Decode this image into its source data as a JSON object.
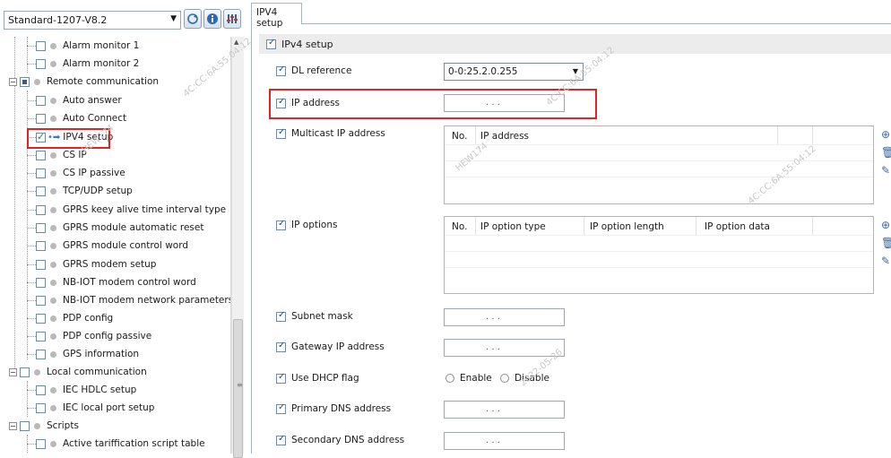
{
  "toolbar": {
    "profile_select_value": "Standard-1207-V8.2",
    "buttons": [
      "refresh-icon",
      "info-icon",
      "settings-icon"
    ]
  },
  "tree": {
    "items": [
      {
        "label": "Alarm monitor 1"
      },
      {
        "label": "Alarm monitor 2"
      },
      {
        "label": "Remote communication"
      },
      {
        "label": "Auto answer"
      },
      {
        "label": "Auto Connect"
      },
      {
        "label": "IPV4 setup"
      },
      {
        "label": "CS IP"
      },
      {
        "label": "CS IP passive"
      },
      {
        "label": "TCP/UDP setup"
      },
      {
        "label": "GPRS keey alive time interval type"
      },
      {
        "label": "GPRS module automatic reset"
      },
      {
        "label": "GPRS module control word"
      },
      {
        "label": "GPRS modem setup"
      },
      {
        "label": "NB-IOT modem control word"
      },
      {
        "label": "NB-IOT modem network parameters"
      },
      {
        "label": "PDP config"
      },
      {
        "label": "PDP config passive"
      },
      {
        "label": "GPS information"
      },
      {
        "label": "Local communication"
      },
      {
        "label": "IEC HDLC setup"
      },
      {
        "label": "IEC local port setup"
      },
      {
        "label": "Scripts"
      },
      {
        "label": "Active tariffication script table"
      }
    ]
  },
  "tab": {
    "label": "IPV4 setup"
  },
  "form": {
    "section_label": "IPv4 setup",
    "dl_reference": {
      "label": "DL reference",
      "value": "0-0:25.2.0.255"
    },
    "ip_address": {
      "label": "IP address",
      "dots": ". . ."
    },
    "multicast": {
      "label": "Multicast IP address",
      "columns": [
        "No.",
        "IP address"
      ]
    },
    "ip_options": {
      "label": "IP options",
      "columns": [
        "No.",
        "IP option type",
        "IP option length",
        "IP option data"
      ]
    },
    "subnet_mask": {
      "label": "Subnet mask",
      "dots": ". . ."
    },
    "gateway": {
      "label": "Gateway IP address",
      "dots": ". . ."
    },
    "dhcp": {
      "label": "Use DHCP flag",
      "options": [
        "Enable",
        "Disable"
      ]
    },
    "primary_dns": {
      "label": "Primary DNS address",
      "dots": ". . ."
    },
    "secondary_dns": {
      "label": "Secondary DNS address",
      "dots": ". . ."
    }
  },
  "grid_actions": [
    "add-row-icon",
    "delete-icon",
    "edit-icon"
  ],
  "watermark": [
    "HEW174",
    "4C:CC:6A:55:04:12",
    "2022-05-26"
  ]
}
